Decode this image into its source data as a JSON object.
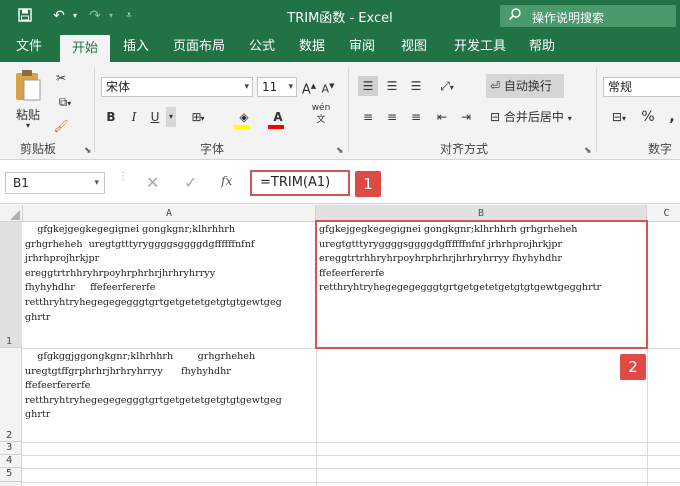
{
  "window": {
    "title": "TRIM函数 - Excel"
  },
  "quick_access": {
    "save_icon": "save-icon",
    "undo_icon": "undo-icon",
    "redo_icon": "redo-icon",
    "customize_icon": "customize-qat-icon"
  },
  "tell_me": {
    "label": "操作说明搜索",
    "icon": "search-icon"
  },
  "tabs": [
    {
      "label": "文件"
    },
    {
      "label": "开始"
    },
    {
      "label": "插入"
    },
    {
      "label": "页面布局"
    },
    {
      "label": "公式"
    },
    {
      "label": "数据"
    },
    {
      "label": "审阅"
    },
    {
      "label": "视图"
    },
    {
      "label": "开发工具"
    },
    {
      "label": "帮助"
    }
  ],
  "active_tab": "开始",
  "ribbon": {
    "clipboard": {
      "paste_label": "粘贴",
      "group_label": "剪贴板"
    },
    "font": {
      "font_name": "宋体",
      "font_size": "11",
      "bold": "B",
      "italic": "I",
      "underline": "U",
      "group_label": "字体",
      "phonetic": "wén"
    },
    "alignment": {
      "wrap_text": "自动换行",
      "merge_center": "合并后居中",
      "group_label": "对齐方式"
    },
    "number": {
      "format": "常规",
      "percent": "%",
      "comma": ",",
      "group_label": "数字"
    }
  },
  "formula_bar": {
    "name_box": "B1",
    "fx": "fx",
    "formula": "=TRIM(A1)",
    "cancel_icon": "cancel-icon",
    "enter_icon": "check-icon"
  },
  "callouts": {
    "one": "1",
    "two": "2"
  },
  "sheet": {
    "columns": [
      "A",
      "B",
      "C"
    ],
    "rows": [
      "1",
      "2",
      "3",
      "4",
      "5"
    ],
    "cells": {
      "A1": [
        "    gfgkejgegkegegignei gongkgnr;klhrhhrh",
        "grhgrheheh  uregtgtttyryggggsggggdgffffffnfnf",
        "jrhrhprojhrkjpr",
        "ereggtrtrhhryhrpoyhrphrhrjhrhryhrryy",
        "fhyhyhdhr     ffefeerfererfe",
        "retthryhtryhegegegegggtgrtgetgetetgetgtgtgewtgeg",
        "ghrtr"
      ],
      "B1": [
        "gfgkejgegkegegignei gongkgnr;klhrhhrh grhgrheheh",
        "uregtgtttyryggggsggggdgffffffnfnf jrhrhprojhrkjpr",
        "ereggtrtrhhryhrpoyhrphrhrjhrhryhrryy fhyhyhdhr",
        "ffefeerfererfe",
        "retthryhtryhegegegegggtgrtgetgetetgetgtgtgewtgegghrtr"
      ],
      "A2": [
        "    gfgkggjggongkgnr;klhrhhrh        grhgrheheh",
        "uregtgtffgrphrhrjhrhryhrryy      fhyhyhdhr",
        "ffefeerfererfe",
        "retthryhtryhegegegegggtgrtgetgetetgetgtgtgewtgeg",
        "ghrtr"
      ]
    }
  },
  "colors": {
    "brand": "#217346",
    "highlight": "#d9534f",
    "callout": "#e04a44"
  }
}
